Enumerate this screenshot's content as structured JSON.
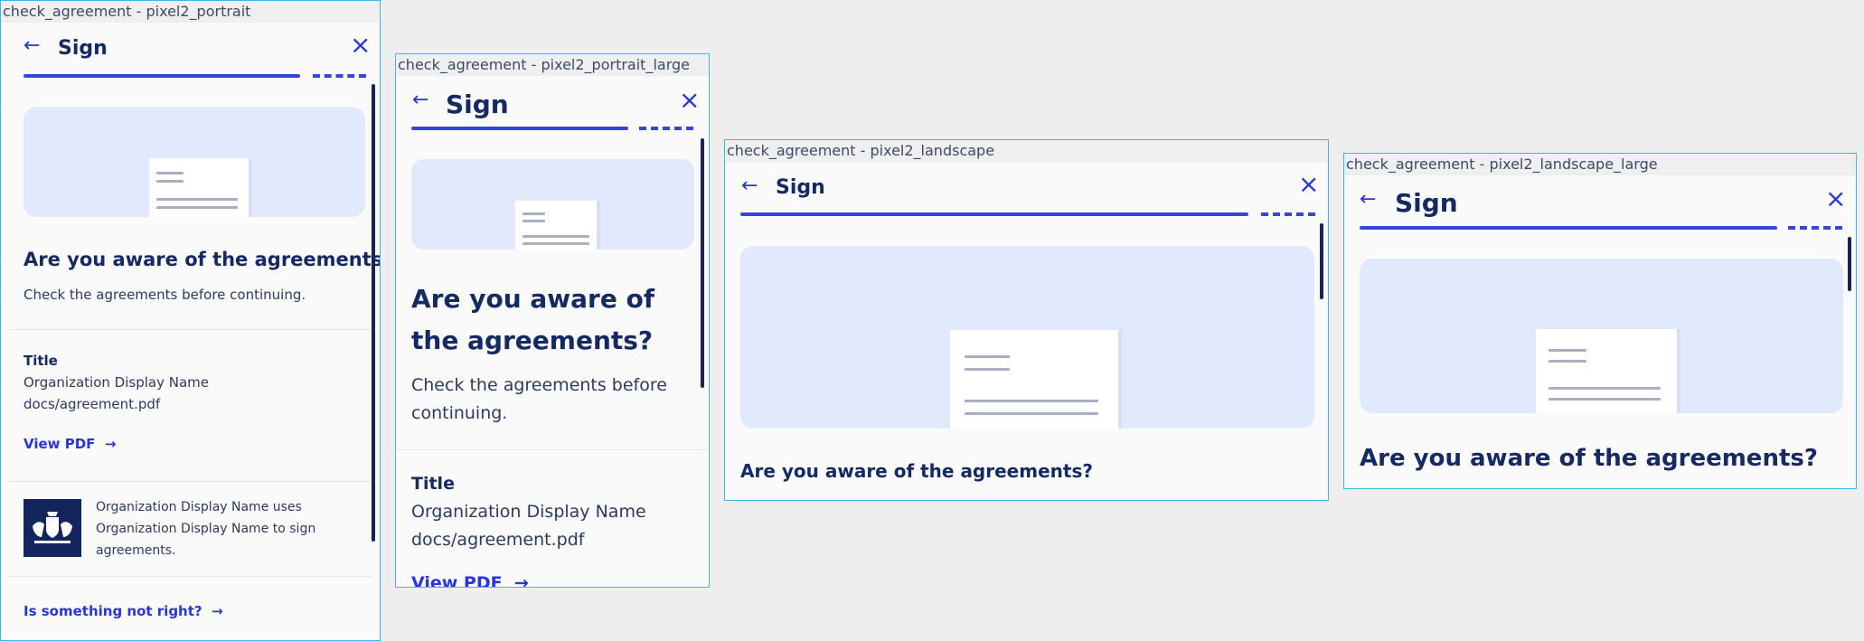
{
  "frames": [
    {
      "label": "check_agreement - pixel2_portrait"
    },
    {
      "label": "check_agreement - pixel2_portrait_large"
    },
    {
      "label": "check_agreement - pixel2_landscape"
    },
    {
      "label": "check_agreement - pixel2_landscape_large"
    }
  ],
  "screen": {
    "back_icon": "←",
    "close_icon": "×",
    "title": "Sign",
    "heading": "Are you aware of the agreements?",
    "subtitle": "Check the agreements before continuing.",
    "doc_title_label": "Title",
    "organization": "Organization Display Name",
    "file": "docs/agreement.pdf",
    "view_pdf": "View PDF",
    "arrow": "→",
    "usage_text": "Organization Display Name uses Organization Display Name to sign agreements.",
    "problem_link": "Is something not right?",
    "logo_icon": "coat-of-arms"
  },
  "colors": {
    "accent": "#3b44d8",
    "text": "#152a62",
    "illustration": "#e1e9fd",
    "logo": "#14245c",
    "frame_border": "#3bb6e6"
  }
}
